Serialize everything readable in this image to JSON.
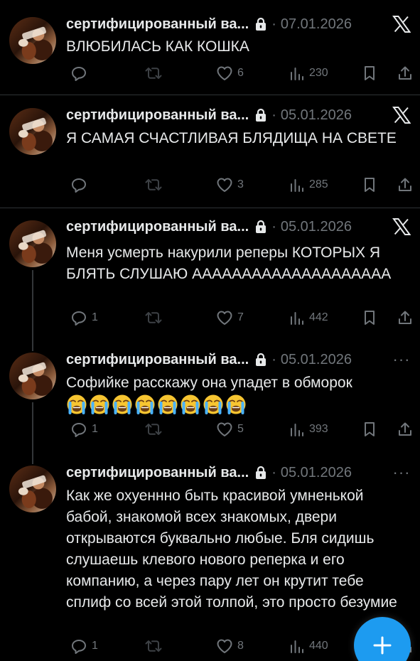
{
  "tweets": [
    {
      "author": "сертифицированный ва...",
      "date": "07.01.2026",
      "corner": "x-logo",
      "text": "ВЛЮБИЛАСЬ КАК КОШКА",
      "replies": "",
      "retweets": "",
      "likes": "6",
      "views": "230"
    },
    {
      "author": "сертифицированный ва...",
      "date": "05.01.2026",
      "corner": "x-logo",
      "text": "Я САМАЯ СЧАСТЛИВАЯ БЛЯДИЩА НА СВЕТЕ",
      "replies": "",
      "retweets": "",
      "likes": "3",
      "views": "285"
    },
    {
      "author": "сертифицированный ва...",
      "date": "05.01.2026",
      "corner": "x-logo",
      "text": "Меня усмерть накурили реперы КОТОРЫХ Я БЛЯТЬ СЛУШАЮ АААААААААААААААААААА",
      "replies": "1",
      "retweets": "",
      "likes": "7",
      "views": "442"
    },
    {
      "author": "сертифицированный ва...",
      "date": "05.01.2026",
      "corner": "more",
      "more_label": "···",
      "text": "Софийке расскажу она упадет в обморок",
      "emoji_count": 8,
      "replies": "1",
      "retweets": "",
      "likes": "5",
      "views": "393"
    },
    {
      "author": "сертифицированный ва...",
      "date": "05.01.2026",
      "corner": "more",
      "more_label": "···",
      "text": "Как же охуеннно быть красивой умненькой бабой, знакомой всех знакомых, двери открываются буквально любые. Бля сидишь слушаешь клевого нового реперка и его компанию, а через пару лет он крутит тебе сплиф со всей этой толпой, это просто безумие",
      "replies": "1",
      "retweets": "",
      "likes": "8",
      "views": "440"
    }
  ],
  "separator": "·",
  "icons": {
    "lock": "lock-icon",
    "reply": "reply-icon",
    "retweet": "retweet-icon",
    "like": "heart-icon",
    "views": "views-icon",
    "bookmark": "bookmark-icon",
    "share": "share-icon",
    "compose": "plus-icon",
    "x": "x-logo-icon",
    "emoji": "loudly-crying-face-icon"
  },
  "colors": {
    "background": "#000000",
    "text": "#e7e9ea",
    "secondary": "#71767b",
    "divider": "#2f3336",
    "accent": "#1d9bf0"
  }
}
